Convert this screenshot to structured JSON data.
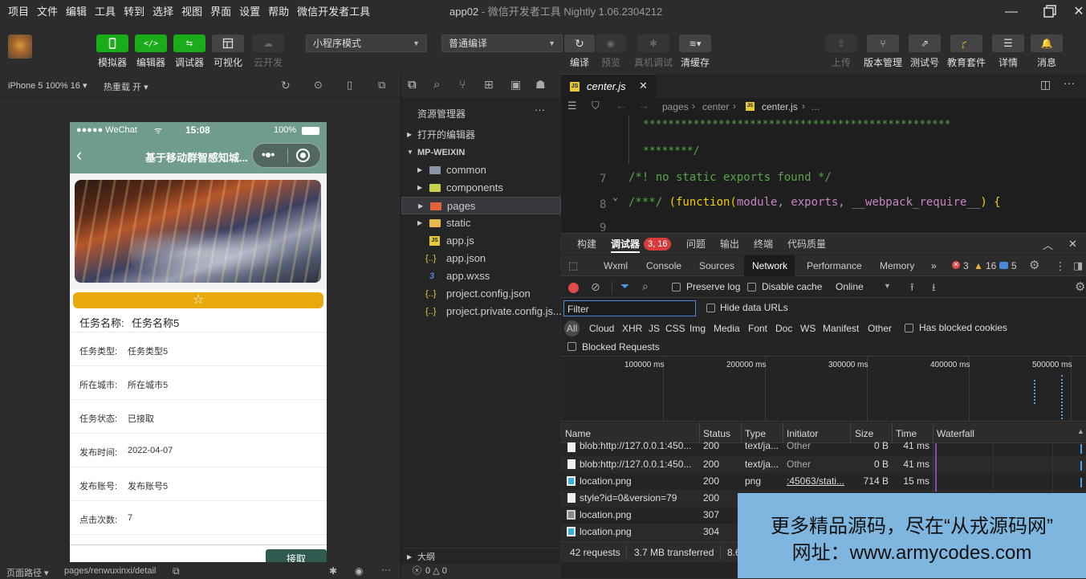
{
  "menubar": {
    "items": [
      "项目",
      "文件",
      "编辑",
      "工具",
      "转到",
      "选择",
      "视图",
      "界面",
      "设置",
      "帮助",
      "微信开发者工具"
    ],
    "title_app": "app02",
    "title_sep": " - ",
    "title_rest": "微信开发者工具 Nightly 1.06.2304212"
  },
  "toolbar": {
    "simulator": "模拟器",
    "editor": "编辑器",
    "debugger": "调试器",
    "visual": "可视化",
    "cloud": "云开发",
    "mode_select": "小程序模式",
    "compile_select": "普通编译",
    "compile": "编译",
    "preview": "预览",
    "remote_debug": "真机调试",
    "clear_cache": "清缓存",
    "upload": "上传",
    "version": "版本管理",
    "test_account": "测试号",
    "edu": "教育套件",
    "details": "详情",
    "messages": "消息",
    "colors": {
      "green": "#1aad19",
      "accent": "#07c160"
    }
  },
  "simbar": {
    "device": "iPhone 5 100% 16 ▾",
    "hotreload": "热重载 开 ▾"
  },
  "phone": {
    "carrier": "●●●●● WeChat",
    "time": "15:08",
    "battery": "100%",
    "nav_title": "基于移动群智感知城...",
    "task_name_label": "任务名称:",
    "task_name_value": "任务名称5",
    "rows": [
      {
        "k": "任务类型:",
        "v": "任务类型5"
      },
      {
        "k": "所在城市:",
        "v": "所在城市5"
      },
      {
        "k": "任务状态:",
        "v": "已接取"
      },
      {
        "k": "发布时间:",
        "v": "2022-04-07"
      },
      {
        "k": "发布账号:",
        "v": "发布账号5"
      },
      {
        "k": "点击次数:",
        "v": "7"
      }
    ],
    "accept_button": "接取"
  },
  "simstatus": {
    "path_label": "页面路径 ▾",
    "path": "pages/renwuxinxi/detail"
  },
  "explorer": {
    "title": "资源管理器",
    "open_editors": "打开的编辑器",
    "project": "MP-WEIXIN",
    "items": [
      {
        "name": "common",
        "type": "folder"
      },
      {
        "name": "components",
        "type": "folder"
      },
      {
        "name": "pages",
        "type": "folder"
      },
      {
        "name": "static",
        "type": "folder"
      },
      {
        "name": "app.js",
        "type": "js"
      },
      {
        "name": "app.json",
        "type": "json"
      },
      {
        "name": "app.wxss",
        "type": "css"
      },
      {
        "name": "project.config.json",
        "type": "json"
      },
      {
        "name": "project.private.config.js...",
        "type": "json"
      }
    ],
    "outline": "大纲",
    "problems": "0 △ 0"
  },
  "editor": {
    "tab": "center.js",
    "breadcrumb": [
      "pages",
      "center",
      "center.js",
      "..."
    ],
    "line_stars": "*************************************************",
    "line_stars_end": "********/",
    "ln7": "7",
    "line7": "/*! no static exports found */",
    "ln8": "8",
    "line8_a": "/***/ ",
    "line8_b": "(function(",
    "line8_c": "module, exports, __webpack_require__",
    "line8_d": ") {",
    "ln9": "9"
  },
  "devtools": {
    "top_tabs": [
      "构建",
      "调试器",
      "问题",
      "输出",
      "终端",
      "代码质量"
    ],
    "badge": "3, 16",
    "panel_tabs": [
      "Wxml",
      "Console",
      "Sources",
      "Network",
      "Performance",
      "Memory"
    ],
    "err_count": "3",
    "warn_count": "16",
    "info_count": "5",
    "preserve_log": "Preserve log",
    "disable_cache": "Disable cache",
    "throttle": "Online",
    "filter_placeholder": "Filter",
    "hide_data_urls": "Hide data URLs",
    "type_filters": [
      "All",
      "Cloud",
      "XHR",
      "JS",
      "CSS",
      "Img",
      "Media",
      "Font",
      "Doc",
      "WS",
      "Manifest",
      "Other"
    ],
    "blocked_cookies": "Has blocked cookies",
    "blocked_requests": "Blocked Requests",
    "timeline_ticks": [
      "100000 ms",
      "200000 ms",
      "300000 ms",
      "400000 ms",
      "500000 ms"
    ],
    "columns": [
      "Name",
      "Status",
      "Type",
      "Initiator",
      "Size",
      "Time",
      "Waterfall"
    ],
    "rows": [
      {
        "name": "blob:http://127.0.0.1:450...",
        "status": "200",
        "type": "text/ja...",
        "initiator": "Other",
        "size": "0 B",
        "time": "41 ms"
      },
      {
        "name": "blob:http://127.0.0.1:450...",
        "status": "200",
        "type": "text/ja...",
        "initiator": "Other",
        "size": "0 B",
        "time": "41 ms"
      },
      {
        "name": "location.png",
        "status": "200",
        "type": "png",
        "initiator": ":45063/stati...",
        "size": "714 B",
        "time": "15 ms"
      },
      {
        "name": "style?id=0&version=79",
        "status": "200",
        "type": "",
        "initiator": "",
        "size": "",
        "time": ""
      },
      {
        "name": "location.png",
        "status": "307",
        "type": "",
        "initiator": "",
        "size": "",
        "time": ""
      },
      {
        "name": "location.png",
        "status": "304",
        "type": "",
        "initiator": "",
        "size": "",
        "time": ""
      }
    ],
    "footer_requests": "42 requests",
    "footer_transferred": "3.7 MB transferred",
    "footer_more": "8.6"
  },
  "watermark": {
    "line1": "更多精品源码，尽在“从戎源码网”",
    "line2": "网址：www.armycodes.com"
  }
}
